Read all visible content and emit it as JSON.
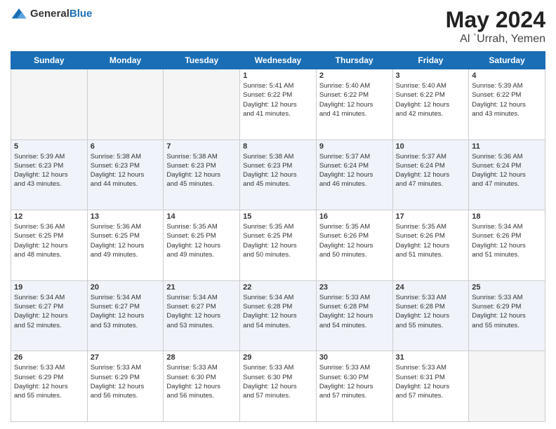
{
  "header": {
    "logo_general": "General",
    "logo_blue": "Blue",
    "month": "May 2024",
    "location": "Al `Urrah, Yemen"
  },
  "days_of_week": [
    "Sunday",
    "Monday",
    "Tuesday",
    "Wednesday",
    "Thursday",
    "Friday",
    "Saturday"
  ],
  "weeks": [
    {
      "shaded": false,
      "days": [
        {
          "num": "",
          "details": ""
        },
        {
          "num": "",
          "details": ""
        },
        {
          "num": "",
          "details": ""
        },
        {
          "num": "1",
          "details": "Sunrise: 5:41 AM\nSunset: 6:22 PM\nDaylight: 12 hours\nand 41 minutes."
        },
        {
          "num": "2",
          "details": "Sunrise: 5:40 AM\nSunset: 6:22 PM\nDaylight: 12 hours\nand 41 minutes."
        },
        {
          "num": "3",
          "details": "Sunrise: 5:40 AM\nSunset: 6:22 PM\nDaylight: 12 hours\nand 42 minutes."
        },
        {
          "num": "4",
          "details": "Sunrise: 5:39 AM\nSunset: 6:22 PM\nDaylight: 12 hours\nand 43 minutes."
        }
      ]
    },
    {
      "shaded": true,
      "days": [
        {
          "num": "5",
          "details": "Sunrise: 5:39 AM\nSunset: 6:23 PM\nDaylight: 12 hours\nand 43 minutes."
        },
        {
          "num": "6",
          "details": "Sunrise: 5:38 AM\nSunset: 6:23 PM\nDaylight: 12 hours\nand 44 minutes."
        },
        {
          "num": "7",
          "details": "Sunrise: 5:38 AM\nSunset: 6:23 PM\nDaylight: 12 hours\nand 45 minutes."
        },
        {
          "num": "8",
          "details": "Sunrise: 5:38 AM\nSunset: 6:23 PM\nDaylight: 12 hours\nand 45 minutes."
        },
        {
          "num": "9",
          "details": "Sunrise: 5:37 AM\nSunset: 6:24 PM\nDaylight: 12 hours\nand 46 minutes."
        },
        {
          "num": "10",
          "details": "Sunrise: 5:37 AM\nSunset: 6:24 PM\nDaylight: 12 hours\nand 47 minutes."
        },
        {
          "num": "11",
          "details": "Sunrise: 5:36 AM\nSunset: 6:24 PM\nDaylight: 12 hours\nand 47 minutes."
        }
      ]
    },
    {
      "shaded": false,
      "days": [
        {
          "num": "12",
          "details": "Sunrise: 5:36 AM\nSunset: 6:25 PM\nDaylight: 12 hours\nand 48 minutes."
        },
        {
          "num": "13",
          "details": "Sunrise: 5:36 AM\nSunset: 6:25 PM\nDaylight: 12 hours\nand 49 minutes."
        },
        {
          "num": "14",
          "details": "Sunrise: 5:35 AM\nSunset: 6:25 PM\nDaylight: 12 hours\nand 49 minutes."
        },
        {
          "num": "15",
          "details": "Sunrise: 5:35 AM\nSunset: 6:25 PM\nDaylight: 12 hours\nand 50 minutes."
        },
        {
          "num": "16",
          "details": "Sunrise: 5:35 AM\nSunset: 6:26 PM\nDaylight: 12 hours\nand 50 minutes."
        },
        {
          "num": "17",
          "details": "Sunrise: 5:35 AM\nSunset: 6:26 PM\nDaylight: 12 hours\nand 51 minutes."
        },
        {
          "num": "18",
          "details": "Sunrise: 5:34 AM\nSunset: 6:26 PM\nDaylight: 12 hours\nand 51 minutes."
        }
      ]
    },
    {
      "shaded": true,
      "days": [
        {
          "num": "19",
          "details": "Sunrise: 5:34 AM\nSunset: 6:27 PM\nDaylight: 12 hours\nand 52 minutes."
        },
        {
          "num": "20",
          "details": "Sunrise: 5:34 AM\nSunset: 6:27 PM\nDaylight: 12 hours\nand 53 minutes."
        },
        {
          "num": "21",
          "details": "Sunrise: 5:34 AM\nSunset: 6:27 PM\nDaylight: 12 hours\nand 53 minutes."
        },
        {
          "num": "22",
          "details": "Sunrise: 5:34 AM\nSunset: 6:28 PM\nDaylight: 12 hours\nand 54 minutes."
        },
        {
          "num": "23",
          "details": "Sunrise: 5:33 AM\nSunset: 6:28 PM\nDaylight: 12 hours\nand 54 minutes."
        },
        {
          "num": "24",
          "details": "Sunrise: 5:33 AM\nSunset: 6:28 PM\nDaylight: 12 hours\nand 55 minutes."
        },
        {
          "num": "25",
          "details": "Sunrise: 5:33 AM\nSunset: 6:29 PM\nDaylight: 12 hours\nand 55 minutes."
        }
      ]
    },
    {
      "shaded": false,
      "days": [
        {
          "num": "26",
          "details": "Sunrise: 5:33 AM\nSunset: 6:29 PM\nDaylight: 12 hours\nand 55 minutes."
        },
        {
          "num": "27",
          "details": "Sunrise: 5:33 AM\nSunset: 6:29 PM\nDaylight: 12 hours\nand 56 minutes."
        },
        {
          "num": "28",
          "details": "Sunrise: 5:33 AM\nSunset: 6:30 PM\nDaylight: 12 hours\nand 56 minutes."
        },
        {
          "num": "29",
          "details": "Sunrise: 5:33 AM\nSunset: 6:30 PM\nDaylight: 12 hours\nand 57 minutes."
        },
        {
          "num": "30",
          "details": "Sunrise: 5:33 AM\nSunset: 6:30 PM\nDaylight: 12 hours\nand 57 minutes."
        },
        {
          "num": "31",
          "details": "Sunrise: 5:33 AM\nSunset: 6:31 PM\nDaylight: 12 hours\nand 57 minutes."
        },
        {
          "num": "",
          "details": ""
        }
      ]
    }
  ]
}
